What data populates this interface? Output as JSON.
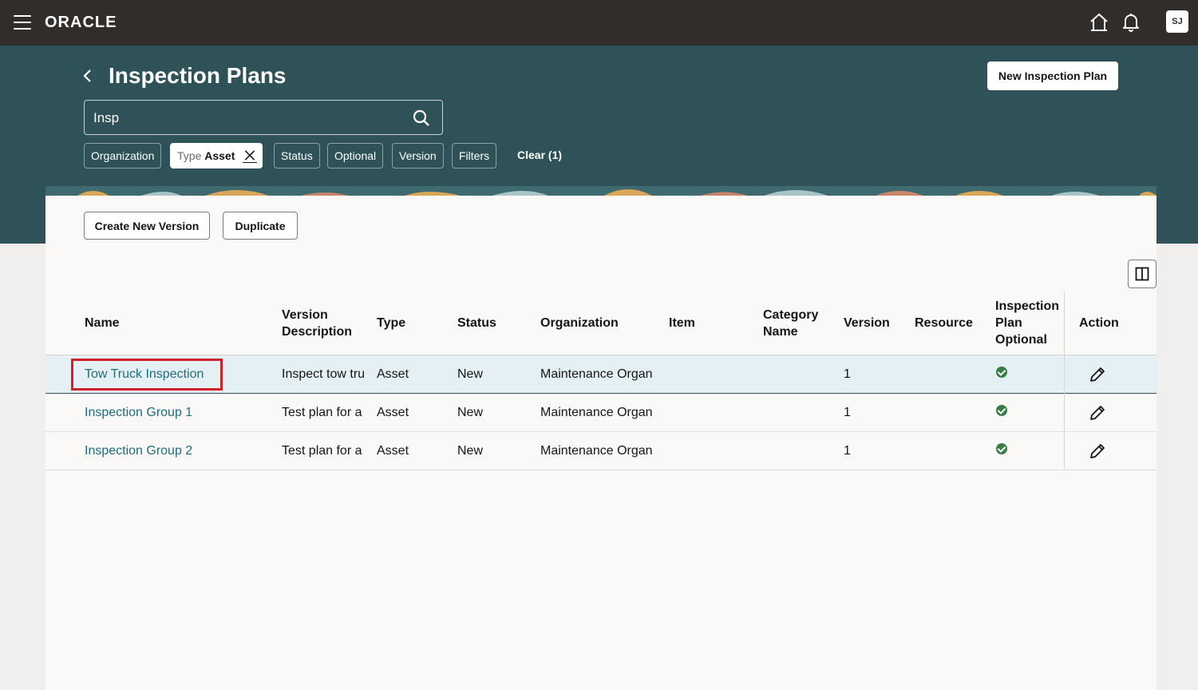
{
  "header": {
    "logo": "ORACLE",
    "avatar": "SJ"
  },
  "page": {
    "title": "Inspection Plans",
    "new_button": "New Inspection Plan",
    "search_value": "Insp"
  },
  "filters": {
    "chips": [
      "Organization",
      "Status",
      "Optional",
      "Version",
      "Filters"
    ],
    "active_chip": {
      "label": "Type",
      "value": "Asset"
    },
    "clear": "Clear (1)"
  },
  "actions": {
    "create_version": "Create New Version",
    "duplicate": "Duplicate"
  },
  "table": {
    "headers": {
      "name": "Name",
      "version_description": "Version Description",
      "type": "Type",
      "status": "Status",
      "organization": "Organization",
      "item": "Item",
      "category_name": "Category Name",
      "version": "Version",
      "resource": "Resource",
      "optional": "Inspection Plan Optional",
      "action": "Action"
    },
    "rows": [
      {
        "name": "Tow Truck Inspection",
        "description": "Inspect tow tru",
        "type": "Asset",
        "status": "New",
        "organization": "Maintenance Organ",
        "version": "1",
        "selected": true
      },
      {
        "name": "Inspection Group 1",
        "description": "Test plan for a",
        "type": "Asset",
        "status": "New",
        "organization": "Maintenance Organ",
        "version": "1"
      },
      {
        "name": "Inspection Group 2",
        "description": "Test plan for a",
        "type": "Asset",
        "status": "New",
        "organization": "Maintenance Organ",
        "version": "1"
      }
    ]
  },
  "colors": {
    "topbar": "#312d2a",
    "band": "#2e5258",
    "link": "#1f6c80",
    "check": "#3a7d44",
    "highlight": "#d0202a"
  }
}
